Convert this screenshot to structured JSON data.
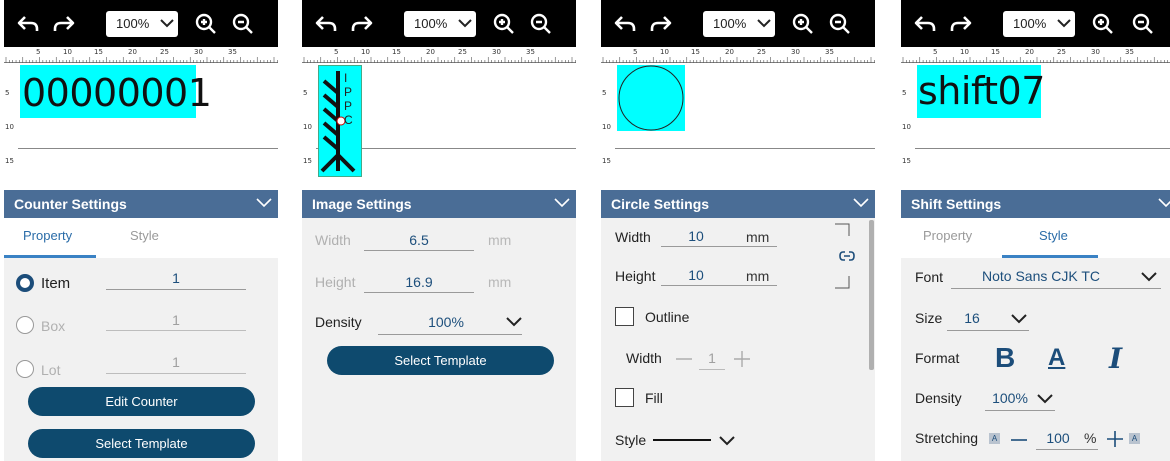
{
  "toolbar": {
    "zoom": "100%",
    "icons": [
      "undo-icon",
      "redo-icon",
      "chevron-down-icon",
      "zoom-in-icon",
      "zoom-out-icon"
    ]
  },
  "ruler": {
    "top_labels": [
      "5",
      "10",
      "15",
      "20",
      "25",
      "30",
      "35"
    ],
    "left_labels": [
      "5",
      "10",
      "15"
    ]
  },
  "colors": {
    "selection": "#00ffff",
    "header": "#4a6d96",
    "button": "#0e4a6e",
    "accent": "#2a6ca8",
    "toolbar": "#000000"
  },
  "counter_panel": {
    "canvas_text": "00000001",
    "header": "Counter Settings",
    "tabs": {
      "property": "Property",
      "style": "Style",
      "active": "Property"
    },
    "options": [
      {
        "label": "Item",
        "value": "1",
        "selected": true
      },
      {
        "label": "Box",
        "value": "1",
        "selected": false
      },
      {
        "label": "Lot",
        "value": "1",
        "selected": false
      }
    ],
    "edit_button": "Edit Counter",
    "template_button": "Select Template"
  },
  "image_panel": {
    "logo_letters": [
      "I",
      "P",
      "P",
      "C"
    ],
    "header": "Image Settings",
    "width_label": "Width",
    "width_value": "6.5",
    "width_unit": "mm",
    "height_label": "Height",
    "height_value": "16.9",
    "height_unit": "mm",
    "density_label": "Density",
    "density_value": "100%",
    "template_button": "Select Template"
  },
  "circle_panel": {
    "header": "Circle Settings",
    "width_label": "Width",
    "width_value": "10",
    "width_unit": "mm",
    "height_label": "Height",
    "height_value": "10",
    "height_unit": "mm",
    "outline_label": "Outline",
    "outline_checked": false,
    "outline_width_label": "Width",
    "outline_width_value": "1",
    "fill_label": "Fill",
    "fill_checked": false,
    "style_label": "Style"
  },
  "shift_panel": {
    "canvas_text": "shift07",
    "header": "Shift Settings",
    "tabs": {
      "property": "Property",
      "style": "Style",
      "active": "Style"
    },
    "font_label": "Font",
    "font_value": "Noto Sans CJK TC",
    "size_label": "Size",
    "size_value": "16",
    "format_label": "Format",
    "format_bold": "B",
    "format_underline": "A",
    "format_italic": "I",
    "density_label": "Density",
    "density_value": "100%",
    "stretching_label": "Stretching",
    "stretching_value": "100",
    "stretching_unit": "%"
  }
}
